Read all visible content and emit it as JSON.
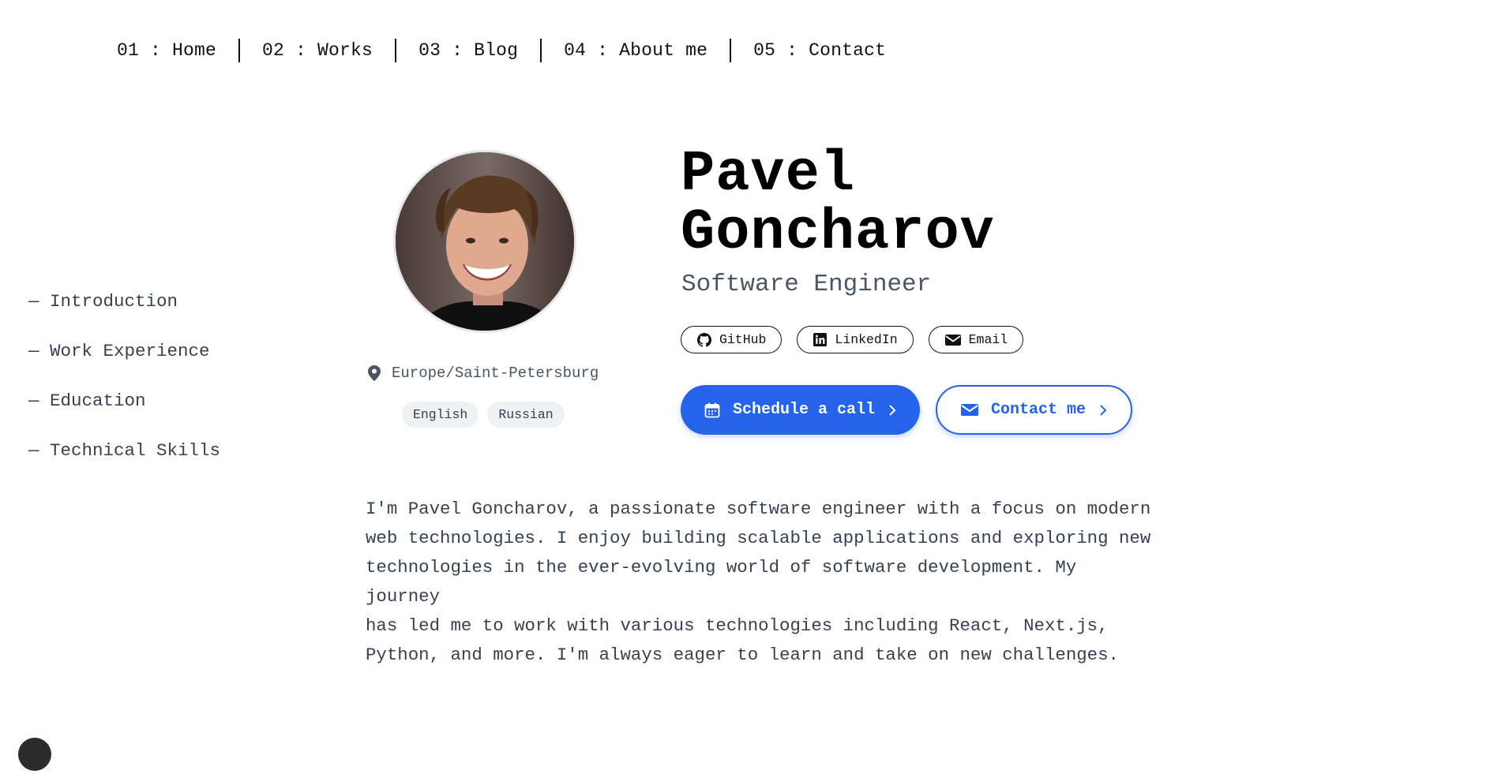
{
  "nav": {
    "items": [
      {
        "label": "01 : Home"
      },
      {
        "label": "02 : Works"
      },
      {
        "label": "03 : Blog"
      },
      {
        "label": "04 : About me"
      },
      {
        "label": "05 : Contact"
      }
    ]
  },
  "toc": {
    "items": [
      {
        "label": "— Introduction"
      },
      {
        "label": "— Work Experience"
      },
      {
        "label": "— Education"
      },
      {
        "label": "— Technical Skills"
      }
    ]
  },
  "profile": {
    "name_line1": "Pavel",
    "name_line2": "Goncharov",
    "role": "Software Engineer",
    "location": "Europe/Saint-Petersburg",
    "location_icon": "map-pin-icon",
    "languages": [
      "English",
      "Russian"
    ]
  },
  "socials": [
    {
      "label": "GitHub",
      "icon": "github-icon"
    },
    {
      "label": "LinkedIn",
      "icon": "linkedin-icon"
    },
    {
      "label": "Email",
      "icon": "envelope-icon"
    }
  ],
  "cta": {
    "schedule": {
      "label": "Schedule a call",
      "icon": "calendar-icon"
    },
    "contact": {
      "label": "Contact me",
      "icon": "envelope-icon"
    }
  },
  "bio": {
    "lines": [
      "I'm Pavel Goncharov, a passionate software engineer with a focus on modern",
      "web technologies. I enjoy building scalable applications and exploring new",
      "technologies in the ever-evolving world of software development. My journey",
      "has led me to work with various technologies including React, Next.js,",
      "Python, and more. I'm always eager to learn and take on new challenges."
    ]
  },
  "colors": {
    "accent": "#2563eb",
    "text": "#374151",
    "heading": "#000000"
  }
}
